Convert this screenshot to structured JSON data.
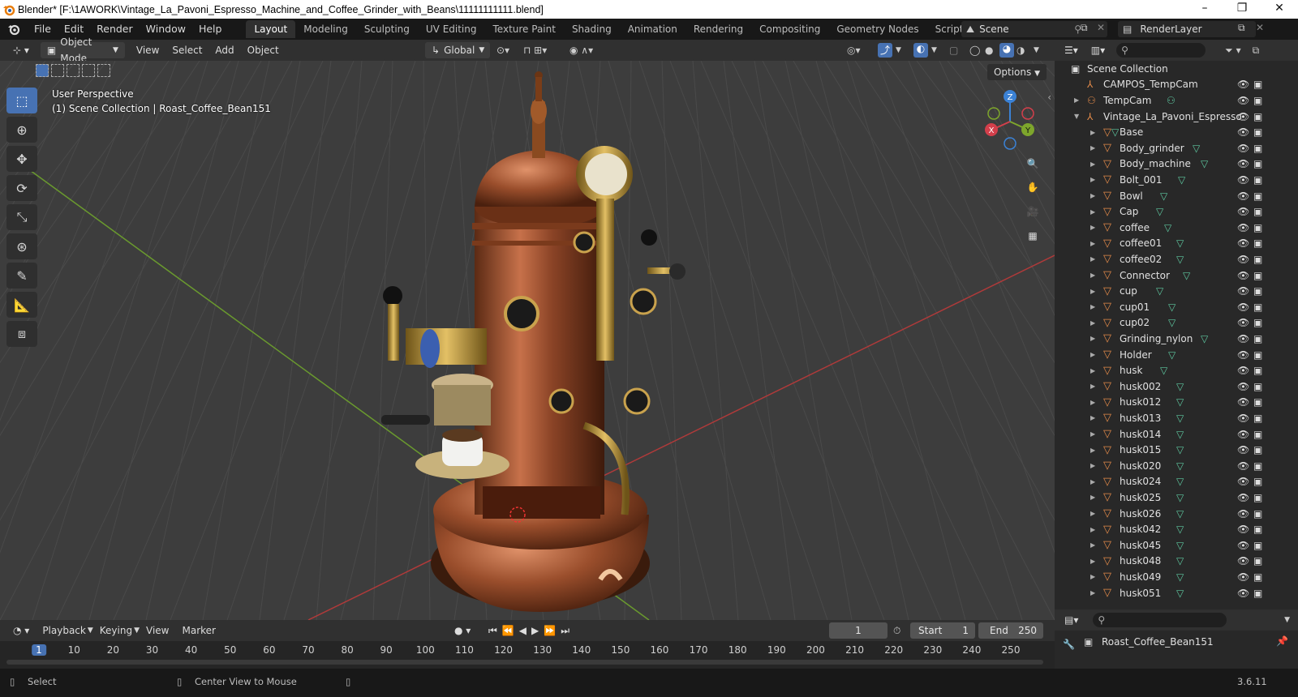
{
  "window": {
    "title": "Blender* [F:\\1AWORK\\Vintage_La_Pavoni_Espresso_Machine_and_Coffee_Grinder_with_Beans\\11111111111.blend]",
    "controls": [
      "–",
      "❐",
      "✕"
    ]
  },
  "menu": [
    "File",
    "Edit",
    "Render",
    "Window",
    "Help"
  ],
  "workspaces": [
    "Layout",
    "Modeling",
    "Sculpting",
    "UV Editing",
    "Texture Paint",
    "Shading",
    "Animation",
    "Rendering",
    "Compositing",
    "Geometry Nodes",
    "Scripting"
  ],
  "active_workspace": "Layout",
  "scene": {
    "name": "Scene",
    "render_layer": "RenderLayer"
  },
  "viewport_header": {
    "mode": "Object Mode",
    "menus": [
      "View",
      "Select",
      "Add",
      "Object"
    ],
    "orientation": "Global"
  },
  "viewport": {
    "perspective": "User Perspective",
    "context": "(1) Scene Collection | Roast_Coffee_Bean151",
    "options": "Options",
    "gizmo": {
      "x": "X",
      "y": "Y",
      "z": "Z"
    }
  },
  "tools": [
    "select-box",
    "cursor",
    "move",
    "rotate",
    "scale",
    "transform",
    "annotate",
    "measure",
    "add-cube"
  ],
  "outliner": {
    "root": "Scene Collection",
    "items": [
      {
        "name": "CAMPOS_TempCam",
        "type": "empty",
        "level": 1
      },
      {
        "name": "TempCam",
        "type": "camera",
        "level": 1
      },
      {
        "name": "Vintage_La_Pavoni_Espresso",
        "type": "empty",
        "level": 1
      },
      {
        "name": "Base",
        "type": "mesh",
        "level": 2
      },
      {
        "name": "Body_grinder",
        "type": "mesh",
        "level": 2
      },
      {
        "name": "Body_machine",
        "type": "mesh",
        "level": 2
      },
      {
        "name": "Bolt_001",
        "type": "mesh",
        "level": 2
      },
      {
        "name": "Bowl",
        "type": "mesh",
        "level": 2
      },
      {
        "name": "Cap",
        "type": "mesh",
        "level": 2
      },
      {
        "name": "coffee",
        "type": "mesh",
        "level": 2
      },
      {
        "name": "coffee01",
        "type": "mesh",
        "level": 2
      },
      {
        "name": "coffee02",
        "type": "mesh",
        "level": 2
      },
      {
        "name": "Connector",
        "type": "mesh",
        "level": 2
      },
      {
        "name": "cup",
        "type": "mesh",
        "level": 2
      },
      {
        "name": "cup01",
        "type": "mesh",
        "level": 2
      },
      {
        "name": "cup02",
        "type": "mesh",
        "level": 2
      },
      {
        "name": "Grinding_nylon",
        "type": "mesh",
        "level": 2
      },
      {
        "name": "Holder",
        "type": "mesh",
        "level": 2
      },
      {
        "name": "husk",
        "type": "mesh",
        "level": 2
      },
      {
        "name": "husk002",
        "type": "mesh",
        "level": 2
      },
      {
        "name": "husk012",
        "type": "mesh",
        "level": 2
      },
      {
        "name": "husk013",
        "type": "mesh",
        "level": 2
      },
      {
        "name": "husk014",
        "type": "mesh",
        "level": 2
      },
      {
        "name": "husk015",
        "type": "mesh",
        "level": 2
      },
      {
        "name": "husk020",
        "type": "mesh",
        "level": 2
      },
      {
        "name": "husk024",
        "type": "mesh",
        "level": 2
      },
      {
        "name": "husk025",
        "type": "mesh",
        "level": 2
      },
      {
        "name": "husk026",
        "type": "mesh",
        "level": 2
      },
      {
        "name": "husk042",
        "type": "mesh",
        "level": 2
      },
      {
        "name": "husk045",
        "type": "mesh",
        "level": 2
      },
      {
        "name": "husk048",
        "type": "mesh",
        "level": 2
      },
      {
        "name": "husk049",
        "type": "mesh",
        "level": 2
      },
      {
        "name": "husk051",
        "type": "mesh",
        "level": 2
      }
    ]
  },
  "properties": {
    "object_name": "Roast_Coffee_Bean151"
  },
  "timeline": {
    "menus": [
      "Playback",
      "Keying",
      "View",
      "Marker"
    ],
    "current_frame": "1",
    "start_label": "Start",
    "start": "1",
    "end_label": "End",
    "end": "250",
    "ticks": [
      "1",
      "10",
      "20",
      "30",
      "40",
      "50",
      "60",
      "70",
      "80",
      "90",
      "100",
      "110",
      "120",
      "130",
      "140",
      "150",
      "160",
      "170",
      "180",
      "190",
      "200",
      "210",
      "220",
      "230",
      "240",
      "250"
    ]
  },
  "status": {
    "left": "Select",
    "middle": "Center View to Mouse",
    "version": "3.6.11"
  },
  "colors": {
    "accent": "#4772b3",
    "mesh_icon": "#e48b4a",
    "mesh_data": "#5ec8a0",
    "axis_red": "#b03a3a",
    "axis_green": "#6a9a2e"
  }
}
